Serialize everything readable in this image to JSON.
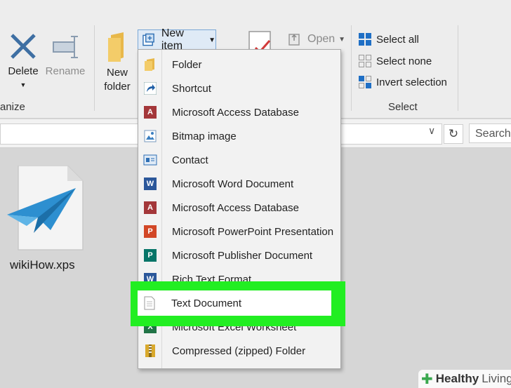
{
  "ribbon": {
    "organize_label": "anize",
    "delete_label": "Delete",
    "rename_label": "Rename",
    "new_folder_label_line1": "New",
    "new_folder_label_line2": "folder",
    "new_item_label": "New item",
    "open_label": "Open",
    "select_all_label": "Select all",
    "select_none_label": "Select none",
    "invert_selection_label": "Invert selection",
    "select_group_label": "Select"
  },
  "address": {
    "search_placeholder": "Search"
  },
  "files": [
    {
      "name": "wikiHow.xps",
      "icon": "xps-file-icon"
    }
  ],
  "menu": {
    "items": [
      {
        "label": "Folder",
        "icon": "folder-icon",
        "accent": "#e8b84a"
      },
      {
        "label": "Shortcut",
        "icon": "shortcut-icon",
        "accent": "#1f5fa6"
      },
      {
        "label": "Microsoft Access Database",
        "icon": "access-icon",
        "accent": "#a4373a"
      },
      {
        "label": "Bitmap image",
        "icon": "bitmap-icon",
        "accent": "#3a7fc1"
      },
      {
        "label": "Contact",
        "icon": "contact-icon",
        "accent": "#2e6fb4"
      },
      {
        "label": "Microsoft Word Document",
        "icon": "word-icon",
        "accent": "#2b579a"
      },
      {
        "label": "Microsoft Access Database",
        "icon": "access-icon",
        "accent": "#a4373a"
      },
      {
        "label": "Microsoft PowerPoint Presentation",
        "icon": "powerpoint-icon",
        "accent": "#d24726"
      },
      {
        "label": "Microsoft Publisher Document",
        "icon": "publisher-icon",
        "accent": "#077568"
      },
      {
        "label": "Rich Text Format",
        "icon": "rtf-icon",
        "accent": "#2b579a"
      },
      {
        "label": "Text Document",
        "icon": "text-document-icon",
        "accent": "#888888"
      },
      {
        "label": "Microsoft Excel Worksheet",
        "icon": "excel-icon",
        "accent": "#217346"
      },
      {
        "label": "Compressed (zipped) Folder",
        "icon": "zip-folder-icon",
        "accent": "#d9a92c"
      }
    ],
    "highlighted_label": "Text Document"
  },
  "watermark": {
    "brand": "Healthy",
    "brand2": "Living"
  },
  "colors": {
    "highlight": "#22ee22",
    "select_blue": "#1f6fc5"
  }
}
